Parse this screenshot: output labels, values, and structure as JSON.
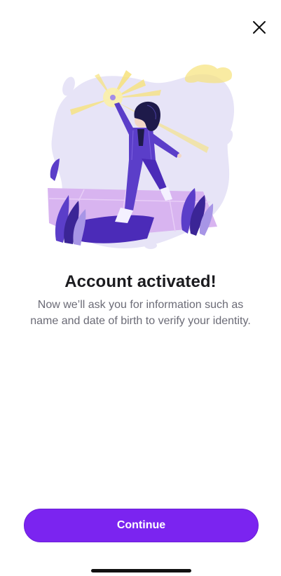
{
  "header": {
    "close_icon": "close-icon"
  },
  "illustration": {
    "icon": "celebration-illustration",
    "colors": {
      "backdrop": "#e7e4f7",
      "purple": "#5b3ec9",
      "dark_purple": "#3b2596",
      "light_purple": "#a795e6",
      "pink": "#d8b4f0",
      "yellow": "#f7e27a",
      "hair": "#1e1a4a"
    }
  },
  "content": {
    "title": "Account activated!",
    "subtitle": "Now we’ll ask you for information such as name and date of birth to verify your identity."
  },
  "actions": {
    "continue_label": "Continue",
    "accent_color": "#7b24f0"
  }
}
